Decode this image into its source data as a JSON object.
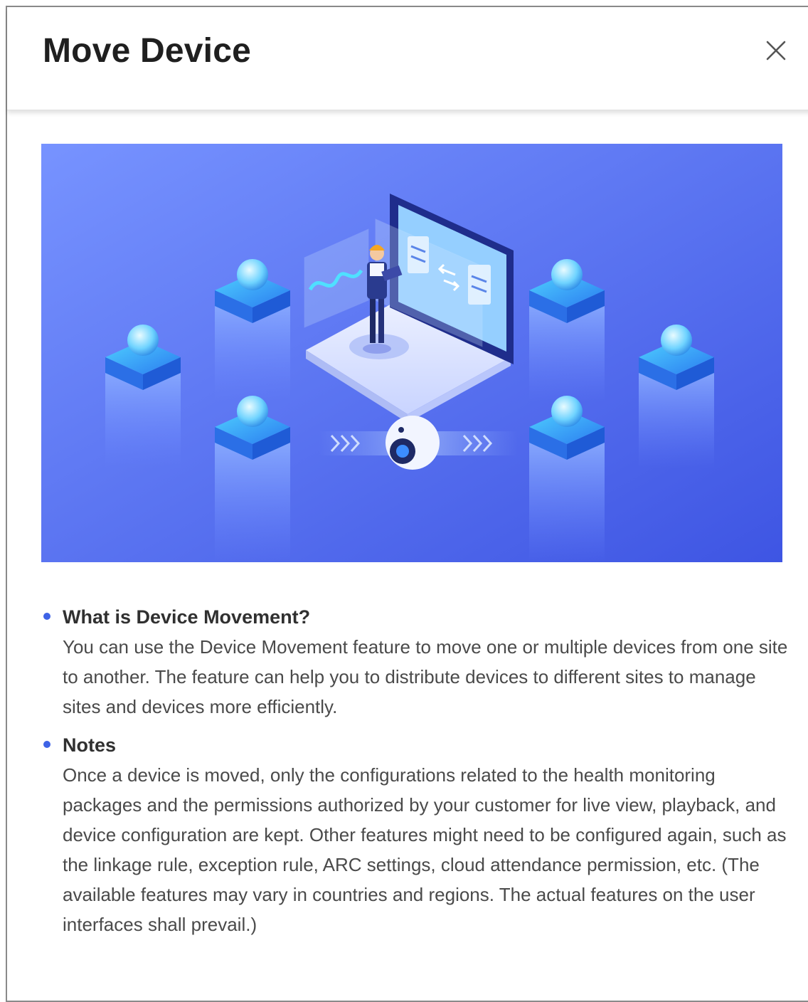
{
  "dialog": {
    "title": "Move Device",
    "close_icon": "close-icon",
    "illustration": {
      "description_icon": "device-movement-illustration",
      "gradient_colors": [
        "#6b8bff",
        "#4158e6"
      ]
    }
  },
  "notes": [
    {
      "heading": "What is Device Movement?",
      "text": "You can use the Device Movement feature to move one or multiple devices from one site to another. The feature can help you to distribute devices to different sites to manage sites and devices more efficiently."
    },
    {
      "heading": "Notes",
      "text": "Once a device is moved, only the configurations related to the health monitoring packages and the permissions authorized by your customer for live view, playback, and device configuration are kept. Other features might need to be configured again, such as the linkage rule, exception rule, ARC settings, cloud attendance permission, etc. (The available features may vary in countries and regions. The actual features on the user interfaces shall prevail.)"
    }
  ],
  "colors": {
    "accent": "#3e63e6",
    "title": "#1f1f1f",
    "text": "#4a4a4a"
  }
}
